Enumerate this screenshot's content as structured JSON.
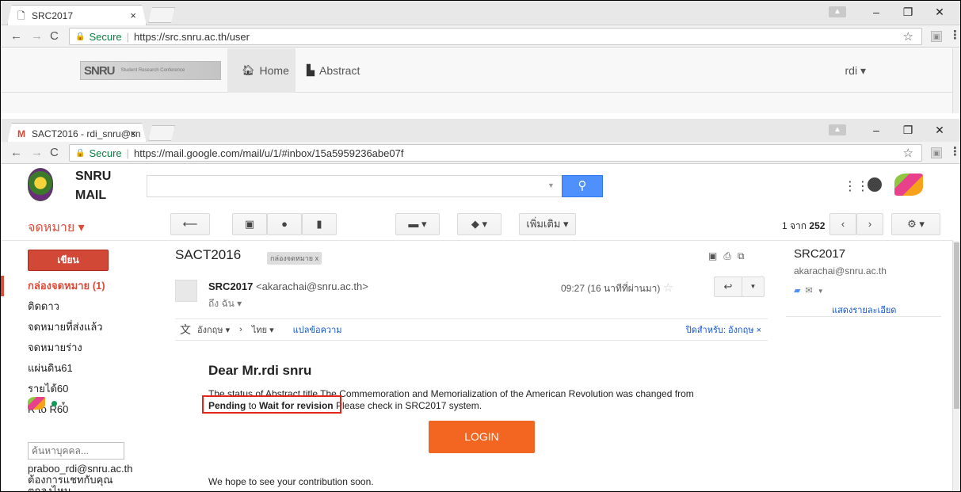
{
  "top_window": {
    "tab_title": "SRC2017",
    "tab_close": "×",
    "secure": "Secure",
    "url": "https://src.snru.ac.th/user",
    "logo_text": "SNRU",
    "logo_sub": "Student Research Conference",
    "nav_home": "Home",
    "nav_abstract": "Abstract",
    "user_menu": "rdi ▾"
  },
  "gmail_window": {
    "tab_title": "SACT2016 - rdi_snru@sn",
    "tab_close": "×",
    "secure": "Secure",
    "url": "https://mail.google.com/mail/u/1/#inbox/15a5959236abe07f",
    "logo_line1": "SNRU",
    "logo_line2": "MAIL",
    "search_value": "",
    "mail_label": "จดหมาย ▾",
    "more_button": "เพิ่มเติม ▾",
    "count_prefix": "1 จาก",
    "count_total": "252",
    "compose": "เขียน",
    "nav_items": [
      "กล่องจดหมาย (1)",
      "ติดดาว",
      "จดหมายที่ส่งแล้ว",
      "จดหมายร่าง",
      "แผ่นดิน61",
      "รายได้60",
      "R to R60"
    ],
    "people_search_placeholder": "ค้นหาบุคคล...",
    "chat_message": "praboo_rdi@snru.ac.th ต้องการแชทกับคุณ ตกลงไหม",
    "subject": "SACT2016",
    "inbox_tag": "กล่องจดหมาย   x",
    "sender_name": "SRC2017",
    "sender_email": "<akarachai@snru.ac.th>",
    "to_me": "ถึง ฉัน ▾",
    "time": "09:27 (16 นาทีที่ผ่านมา)",
    "translate_from": "อังกฤษ ▾",
    "translate_arrow": "›",
    "translate_to": "ไทย ▾",
    "translate_link": "แปลข้อความ",
    "translate_off": "ปิดสำหรับ: อังกฤษ ×",
    "greeting": "Dear Mr.rdi snru",
    "status_line": "The status of Abstract title The Commemoration and Memorialization of the American Revolution was changed from",
    "status_from": "Pending",
    "status_to_word": "to",
    "status_to": "Wait for revision",
    "status_tail": "Please check in SRC2017 system.",
    "login_button": "LOGIN",
    "closing": "We hope to see your contribution soon.",
    "side_name": "SRC2017",
    "side_email": "akarachai@snru.ac.th",
    "side_detail": "แสดงรายละเอียด"
  },
  "colors": {
    "gmail_red": "#dd4b39",
    "search_blue": "#4d90fe",
    "login_orange": "#f26622",
    "highlight_red": "#e3241b"
  }
}
